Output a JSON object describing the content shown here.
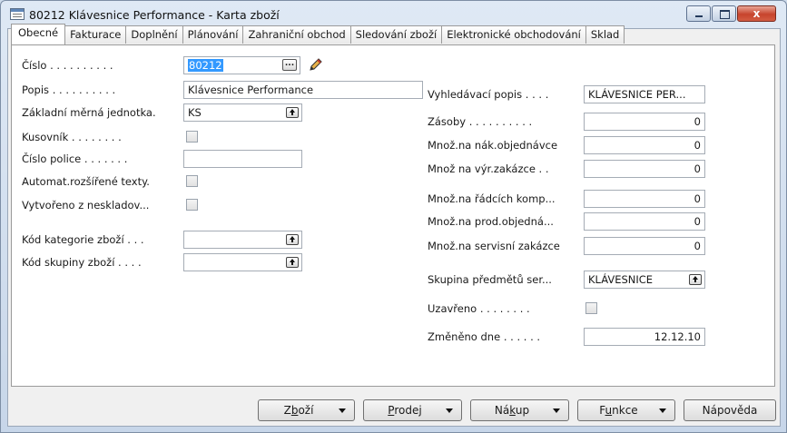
{
  "window": {
    "title": "80212 Klávesnice Performance - Karta zboží"
  },
  "tabs": [
    "Obecné",
    "Fakturace",
    "Doplnění",
    "Plánování",
    "Zahraniční obchod",
    "Sledování zboží",
    "Elektronické obchodování",
    "Sklad"
  ],
  "left": {
    "cislo": {
      "label": "Číslo . . . . . . . . . .",
      "value": "80212"
    },
    "popis": {
      "label": "Popis . . . . . . . . . .",
      "value": "Klávesnice Performance"
    },
    "jednotka": {
      "label": "Základní měrná jednotka.",
      "value": "KS"
    },
    "kusovnik": {
      "label": "Kusovník . . . . . . . ."
    },
    "police": {
      "label": "Číslo police . . . . . . .",
      "value": ""
    },
    "automat": {
      "label": "Automat.rozšířené texty."
    },
    "vytvoreno": {
      "label": "Vytvořeno z neskladov..."
    },
    "kategorie": {
      "label": "Kód kategorie zboží . . .",
      "value": ""
    },
    "skupina": {
      "label": "Kód skupiny zboží . . . .",
      "value": ""
    }
  },
  "right": {
    "vyhledavaci": {
      "label": "Vyhledávací popis . . . .",
      "value": "KLÁVESNICE PER..."
    },
    "zasoby": {
      "label": "Zásoby . . . . . . . . . .",
      "value": "0"
    },
    "nak": {
      "label": "Množ.na nák.objednávce",
      "value": "0"
    },
    "vyr": {
      "label": "Množ na výr.zakázce . .",
      "value": "0"
    },
    "radcich": {
      "label": "Množ.na řádcích komp...",
      "value": "0"
    },
    "prod": {
      "label": "Množ.na prod.objedná...",
      "value": "0"
    },
    "servisni": {
      "label": "Množ.na servisní zakázce",
      "value": "0"
    },
    "skupina_serv": {
      "label": "Skupina předmětů ser...",
      "value": "KLÁVESNICE"
    },
    "uzavreno": {
      "label": "Uzavřeno . . . . . . . ."
    },
    "zmeneno": {
      "label": "Změněno dne . . . . . .",
      "value": "12.12.10"
    }
  },
  "buttons": {
    "zbozi": {
      "pre": "Z",
      "u": "b",
      "post": "oží"
    },
    "prodej": {
      "pre": "",
      "u": "P",
      "post": "rodej"
    },
    "nakup": {
      "pre": "Ná",
      "u": "k",
      "post": "up"
    },
    "funkce": {
      "pre": "F",
      "u": "u",
      "post": "nkce"
    },
    "napoveda": "Nápověda"
  },
  "icons": {
    "ellipsis": "...",
    "close": "x"
  }
}
